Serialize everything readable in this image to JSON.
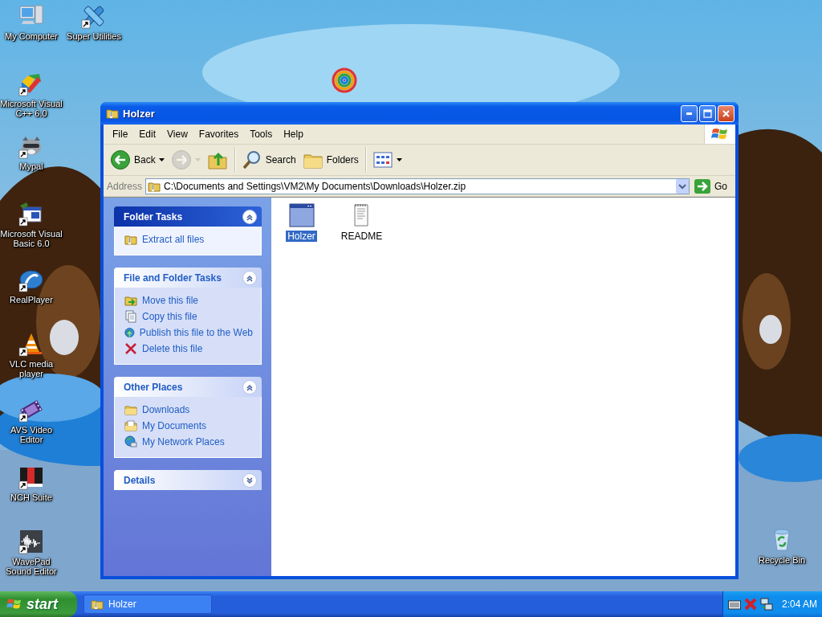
{
  "desktop": {
    "icons": [
      {
        "label": "My Computer",
        "kind": "computer",
        "shortcut": false
      },
      {
        "label": "Super Utilities",
        "kind": "tools",
        "shortcut": true
      },
      {
        "label": "Microsoft Visual C++ 6.0",
        "kind": "vcpp",
        "shortcut": true
      },
      {
        "label": "Mypal",
        "kind": "raccoon",
        "shortcut": true
      },
      {
        "label": "Microsoft Visual Basic 6.0",
        "kind": "vb",
        "shortcut": true
      },
      {
        "label": "RealPlayer",
        "kind": "realplayer",
        "shortcut": true
      },
      {
        "label": "VLC media player",
        "kind": "cone",
        "shortcut": true
      },
      {
        "label": "AVS Video Editor",
        "kind": "film",
        "shortcut": true
      },
      {
        "label": "NCH Suite",
        "kind": "nch",
        "shortcut": true
      },
      {
        "label": "WavePad Sound Editor",
        "kind": "wave",
        "shortcut": true
      },
      {
        "label": "Recycle Bin",
        "kind": "recycle",
        "shortcut": false
      },
      {
        "kind": "spiral",
        "shortcut": false
      }
    ]
  },
  "window": {
    "title": "Holzer",
    "menu": [
      "File",
      "Edit",
      "View",
      "Favorites",
      "Tools",
      "Help"
    ],
    "toolbar": [
      {
        "kind": "back",
        "label": "Back",
        "dropdown": true,
        "disabled": false,
        "separator_before": false
      },
      {
        "kind": "forward",
        "dropdown": true,
        "disabled": true,
        "separator_before": false
      },
      {
        "kind": "up",
        "dropdown": false,
        "disabled": false,
        "separator_before": false
      },
      {
        "kind": "search",
        "label": "Search",
        "dropdown": false,
        "disabled": false,
        "separator_before": true
      },
      {
        "kind": "folders",
        "label": "Folders",
        "dropdown": false,
        "disabled": false,
        "separator_before": false
      },
      {
        "kind": "views",
        "dropdown": true,
        "disabled": false,
        "separator_before": true
      }
    ],
    "address": {
      "label": "Address",
      "value": "C:\\Documents and Settings\\VM2\\My Documents\\Downloads\\Holzer.zip",
      "go": "Go"
    },
    "task_panels": [
      {
        "title": "Folder Tasks",
        "special": true,
        "expanded": true,
        "items": [
          {
            "label": "Extract all files",
            "kind": "zip"
          }
        ]
      },
      {
        "title": "File and Folder Tasks",
        "special": false,
        "expanded": true,
        "items": [
          {
            "label": "Move this file",
            "kind": "move"
          },
          {
            "label": "Copy this file",
            "kind": "copy"
          },
          {
            "label": "Publish this file to the Web",
            "kind": "publish"
          },
          {
            "label": "Delete this file",
            "kind": "delete"
          }
        ]
      },
      {
        "title": "Other Places",
        "special": false,
        "expanded": true,
        "items": [
          {
            "label": "Downloads",
            "kind": "folder"
          },
          {
            "label": "My Documents",
            "kind": "documents"
          },
          {
            "label": "My Network Places",
            "kind": "network"
          }
        ]
      },
      {
        "title": "Details",
        "special": false,
        "expanded": false
      }
    ],
    "files": [
      {
        "name": "Holzer",
        "kind": "app",
        "selected": true
      },
      {
        "name": "README",
        "kind": "text",
        "selected": false
      }
    ]
  },
  "taskbar": {
    "start": "start",
    "buttons": [
      {
        "label": "Holzer"
      }
    ],
    "clock": "2:04 AM"
  }
}
